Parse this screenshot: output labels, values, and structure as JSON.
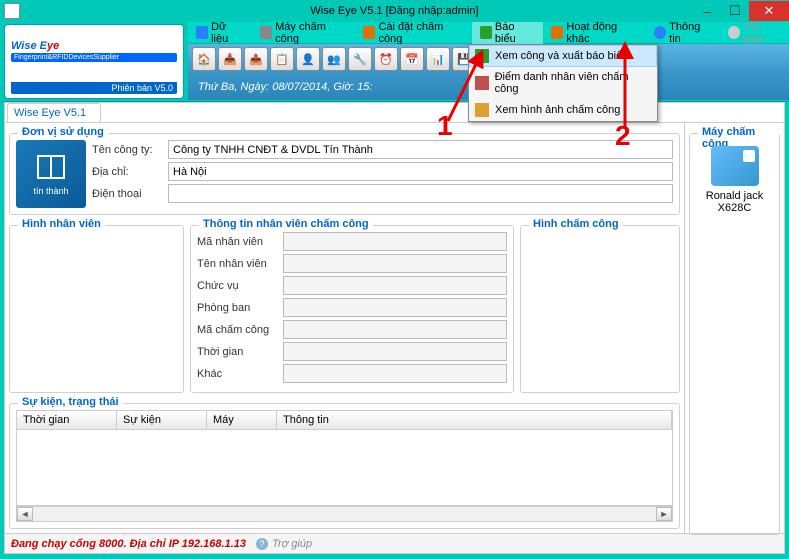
{
  "window": {
    "title": "Wise Eye V5.1 [Đăng nhập:admin]"
  },
  "logo": {
    "brand_a": "Wise E",
    "brand_b": "ye",
    "sub": "Fingerprint&RFIDDevicesSupplier",
    "version": "Phiên bản V5.0"
  },
  "menu": {
    "items": [
      {
        "label": "Dữ liệu",
        "color": "#2a7fff"
      },
      {
        "label": "Máy chấm công",
        "color": "#888"
      },
      {
        "label": "Cài đặt chấm công",
        "color": "#e07000"
      },
      {
        "label": "Báo biểu",
        "color": "#2a9f2a"
      },
      {
        "label": "Hoạt động khác",
        "color": "#e07000"
      },
      {
        "label": "Thông tin",
        "color": "#2a7fff"
      },
      {
        "label": "Trợ giúp",
        "color": "#aaa"
      }
    ]
  },
  "dropdown": {
    "items": [
      {
        "label": "Xem công và xuất báo biểu"
      },
      {
        "label": "Điểm danh nhân viên chấm công"
      },
      {
        "label": "Xem hình ảnh chấm công"
      }
    ]
  },
  "datetime": "Thứ Ba, Ngày: 08/07/2014, Giờ: 15:",
  "tab": {
    "label": "Wise Eye V5.1"
  },
  "unit": {
    "legend": "Đơn vị sử dụng",
    "company_label": "Tên công ty:",
    "company_value": "Công ty TNHH CNĐT & DVDL Tín Thành",
    "address_label": "Địa chỉ:",
    "address_value": "Hà Nội",
    "phone_label": "Điện thoại",
    "phone_value": "",
    "logo_text": "tín thành"
  },
  "emp": {
    "img_legend": "Hình nhân viên",
    "info_legend": "Thông tin nhân viên chấm công",
    "right_legend": "Hình chấm công",
    "fields": {
      "ma": "Mã nhân viên",
      "ten": "Tên nhân viên",
      "chucvu": "Chức vụ",
      "phongban": "Phòng ban",
      "macc": "Mã chấm công",
      "thoigian": "Thời gian",
      "khac": "Khác"
    }
  },
  "events": {
    "legend": "Sự kiện, trạng thái",
    "cols": {
      "thoigian": "Thời gian",
      "sukien": "Sự kiện",
      "may": "Máy",
      "thongtin": "Thông tin"
    }
  },
  "devices": {
    "legend": "Máy chấm công",
    "items": [
      {
        "name": "Ronald jack X628C"
      }
    ]
  },
  "status": {
    "text": "Đang chạy cổng 8000. Địa chỉ IP 192.168.1.13",
    "help": "Trợ giúp"
  },
  "annot": {
    "one": "1",
    "two": "2"
  }
}
